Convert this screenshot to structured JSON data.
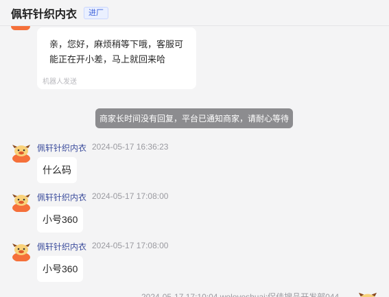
{
  "header": {
    "shop_name": "佩轩针织内衣",
    "badge": "进厂"
  },
  "bot_message": {
    "text": "亲，您好，麻烦稍等下哦，客服可能正在开小差，马上就回来哈",
    "tag": "机器人发送"
  },
  "system_notice": "商家长时间没有回复，平台已通知商家，请耐心等待",
  "messages": [
    {
      "sender": "佩轩针织内衣",
      "time": "2024-05-17 16:36:23",
      "text": "什么码"
    },
    {
      "sender": "佩轩针织内衣",
      "time": "2024-05-17 17:08:00",
      "text": "小号360"
    },
    {
      "sender": "佩轩针织内衣",
      "time": "2024-05-17 17:08:00",
      "text": "小号360"
    }
  ],
  "footer_meta": "2024-05-17 17:10:04  woloveshuai:促佳搜品开发部044",
  "colors": {
    "accent": "#3b4c9c",
    "avatar": "#f5703a",
    "notice_bg": "#8c8c8f"
  }
}
